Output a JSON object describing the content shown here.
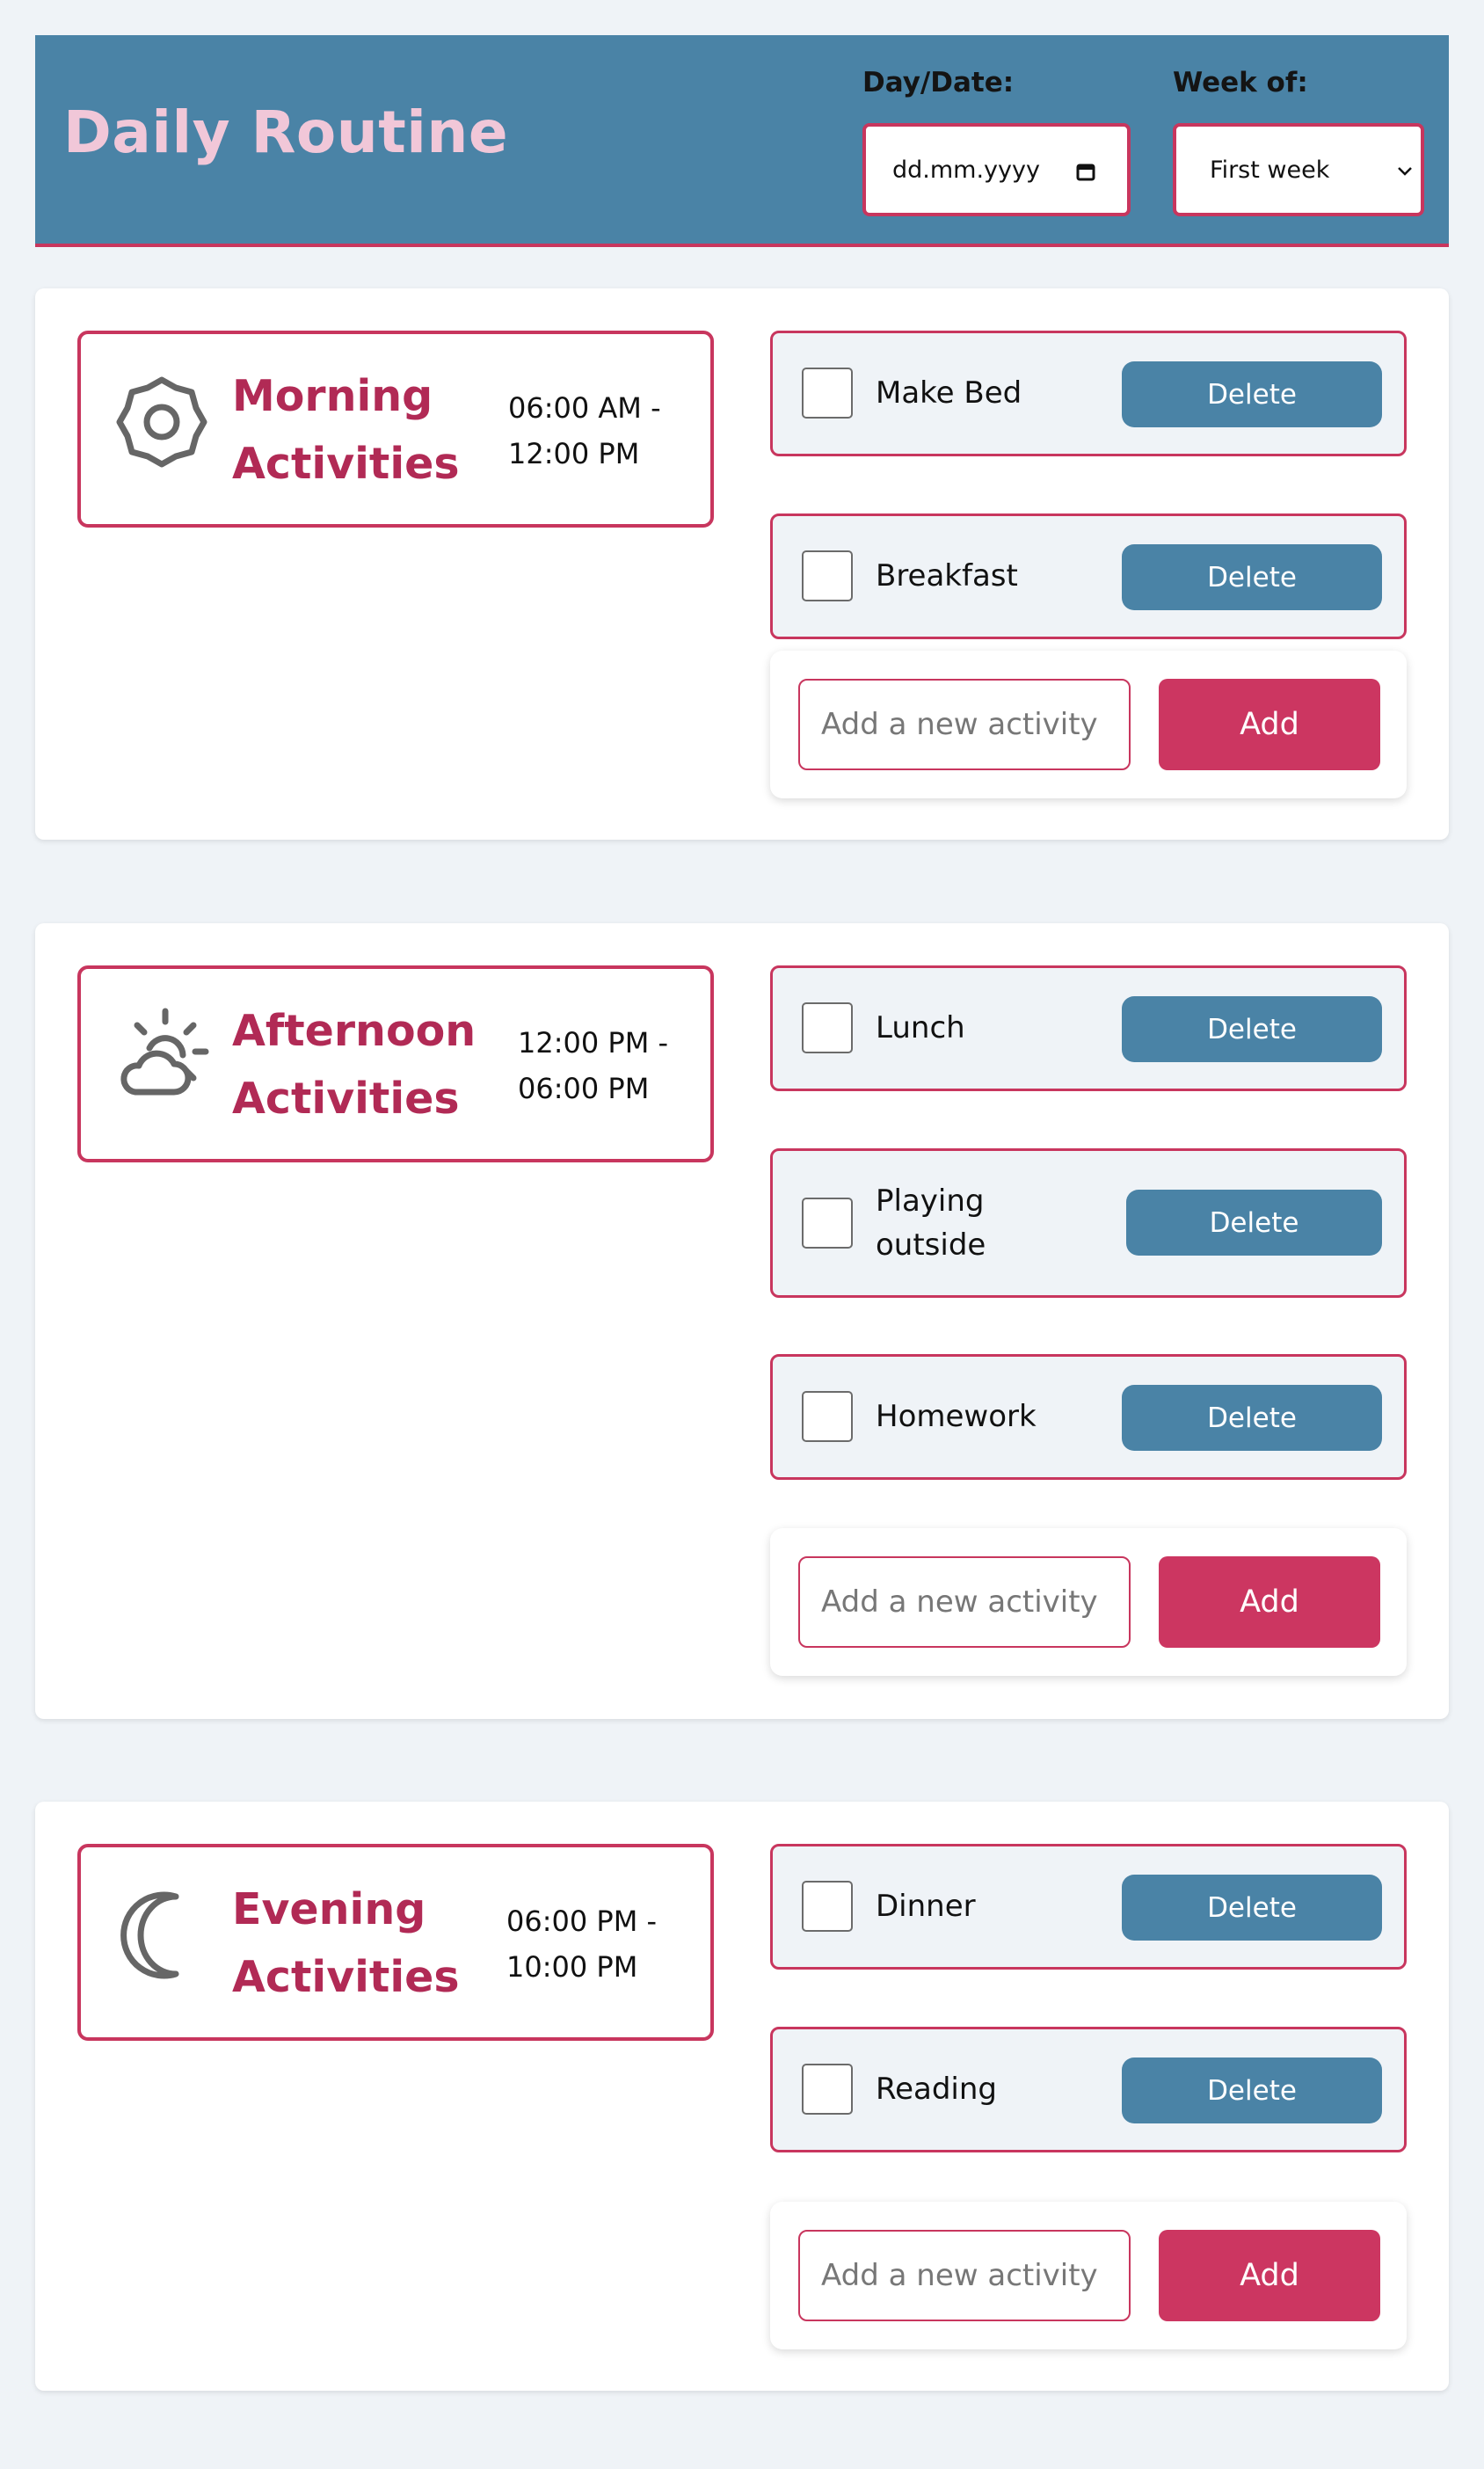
{
  "header": {
    "title": "Daily Routine",
    "date_label": "Day/Date:",
    "date_placeholder": "dd.mm.yyyy",
    "week_label": "Week of:",
    "week_value": "First week"
  },
  "sections": [
    {
      "title_line1": "Morning",
      "title_line2": "Activities",
      "time_line1": "06:00 AM -",
      "time_line2": "12:00 PM",
      "icon": "sun-icon",
      "activities": [
        {
          "label": "Make Bed",
          "checked": false
        },
        {
          "label": "Breakfast",
          "checked": false
        }
      ],
      "add_placeholder": "Add a new activity",
      "add_label": "Add"
    },
    {
      "title_line1": "Afternoon",
      "title_line2": "Activities",
      "time_line1": "12:00 PM -",
      "time_line2": "06:00 PM",
      "icon": "partly-cloudy-icon",
      "activities": [
        {
          "label": "Lunch",
          "checked": false
        },
        {
          "label": "Playing outside",
          "checked": false
        },
        {
          "label": "Homework",
          "checked": false
        }
      ],
      "add_placeholder": "Add a new activity",
      "add_label": "Add"
    },
    {
      "title_line1": "Evening",
      "title_line2": "Activities",
      "time_line1": "06:00 PM -",
      "time_line2": "10:00 PM",
      "icon": "moon-icon",
      "activities": [
        {
          "label": "Dinner",
          "checked": false
        },
        {
          "label": "Reading",
          "checked": false
        }
      ],
      "add_placeholder": "Add a new activity",
      "add_label": "Add"
    }
  ],
  "delete_label": "Delete",
  "colors": {
    "header_bg": "#4a83a6",
    "accent": "#c8365e",
    "title": "#f1c7d8",
    "period_title": "#b12a55",
    "add_button": "#cc3661",
    "delete_button": "#4a83a6",
    "page_bg": "#eff3f7"
  }
}
